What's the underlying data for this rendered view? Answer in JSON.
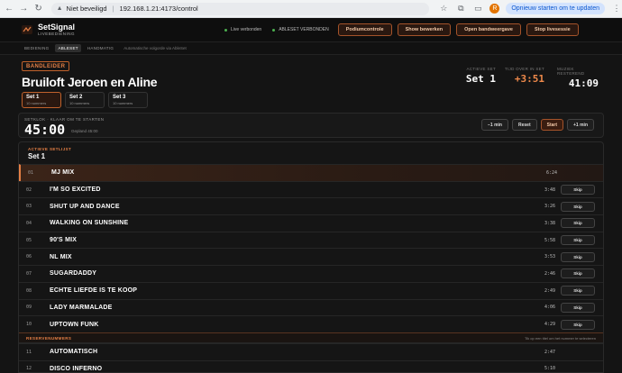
{
  "browser": {
    "security_label": "Niet beveiligd",
    "url": "192.168.1.21:4173/control",
    "restart_label": "Opnieuw starten om te updaten",
    "profile_initial": "R"
  },
  "header": {
    "app_title": "SetSignal",
    "app_subtitle": "LIVEBEDIENING",
    "status_live": "Live verbonden",
    "status_ableset": "ABLESET VERBONDEN",
    "buttons": [
      "Podiumcontrole",
      "Show bewerken",
      "Open bandweergave",
      "Stop livesessie"
    ]
  },
  "subnav": {
    "items": [
      "BEDIENING",
      "ABLESET",
      "HANDMATIG"
    ],
    "active_index": 1,
    "note": "Automatische volgorde via AbleSet"
  },
  "band": {
    "role_tag": "BANDLEIDER",
    "name": "Bruiloft Jeroen en Aline"
  },
  "stats": [
    {
      "label": "ACTIEVE SET",
      "value": "Set 1",
      "accent": false
    },
    {
      "label": "TIJD OVER IN SET",
      "value": "+3:51",
      "accent": true
    },
    {
      "label": "MUZIEK RESTEREND",
      "value": "41:09",
      "accent": false
    }
  ],
  "sets": [
    {
      "title": "Set 1",
      "subtitle": "10 nummers",
      "active": true
    },
    {
      "title": "Set 2",
      "subtitle": "10 nummers",
      "active": false
    },
    {
      "title": "Set 3",
      "subtitle": "10 nummers",
      "active": false
    }
  ],
  "countdown": {
    "label": "SETKLOK · KLAAR OM TE STARTEN",
    "time": "45:00",
    "planned": "Gepland 45:00",
    "buttons": [
      "−1 min",
      "Reset",
      "Start",
      "+1 min"
    ]
  },
  "setlist": {
    "label": "ACTIEVE SETLIJST",
    "title": "Set 1",
    "skip_label": "Skip",
    "songs": [
      {
        "num": "01",
        "title": "MJ MIX",
        "duration": "6:24",
        "current": true
      },
      {
        "num": "02",
        "title": "I'M SO EXCITED",
        "duration": "3:48",
        "current": false
      },
      {
        "num": "03",
        "title": "SHUT UP AND DANCE",
        "duration": "3:26",
        "current": false
      },
      {
        "num": "04",
        "title": "WALKING ON SUNSHINE",
        "duration": "3:38",
        "current": false
      },
      {
        "num": "05",
        "title": "90'S MIX",
        "duration": "5:58",
        "current": false
      },
      {
        "num": "06",
        "title": "NL MIX",
        "duration": "3:53",
        "current": false
      },
      {
        "num": "07",
        "title": "SUGARDADDY",
        "duration": "2:46",
        "current": false
      },
      {
        "num": "08",
        "title": "ECHTE LIEFDE IS TE KOOP",
        "duration": "2:49",
        "current": false
      },
      {
        "num": "09",
        "title": "LADY MARMALADE",
        "duration": "4:06",
        "current": false
      },
      {
        "num": "10",
        "title": "UPTOWN FUNK",
        "duration": "4:29",
        "current": false
      }
    ],
    "reserve_label": "RESERVENUMMERS",
    "reserve_hint": "Tik op een titel om het nummer te selecteren",
    "reserves": [
      {
        "num": "11",
        "title": "AUTOMATISCH",
        "duration": "2:47"
      },
      {
        "num": "12",
        "title": "DISCO INFERNO",
        "duration": "5:10"
      }
    ]
  },
  "colors": {
    "accent": "#e57f45",
    "live_dot": "#4caf50",
    "background": "#141414"
  }
}
